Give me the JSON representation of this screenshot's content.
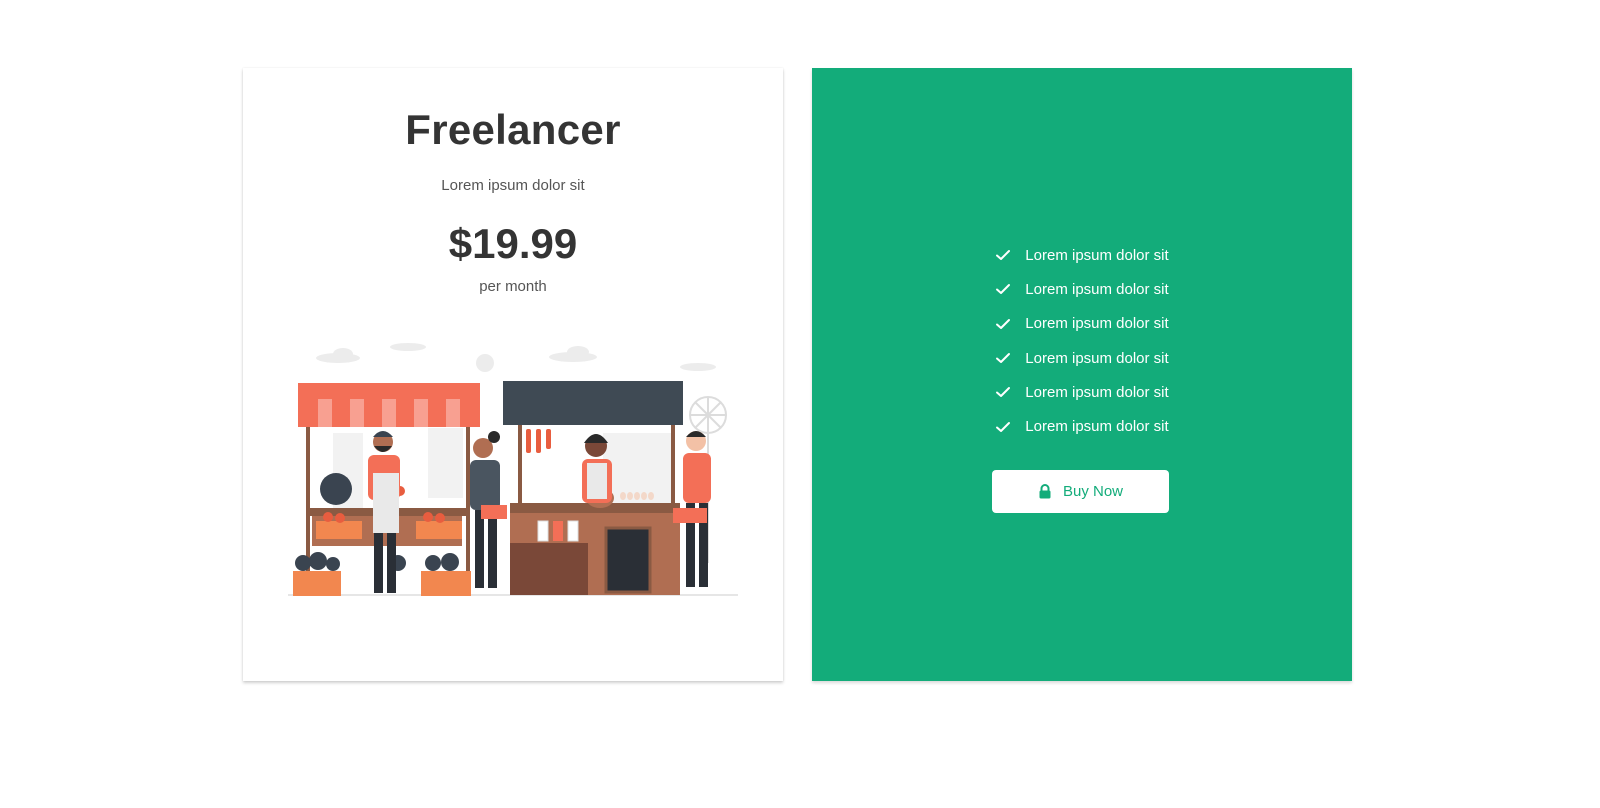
{
  "plan": {
    "title": "Freelancer",
    "subtitle": "Lorem ipsum dolor sit",
    "price": "$19.99",
    "period": "per month",
    "illustration_icon": "farmers-market-illustration"
  },
  "features": [
    {
      "label": "Lorem ipsum dolor sit",
      "icon": "check-icon"
    },
    {
      "label": "Lorem ipsum dolor sit",
      "icon": "check-icon"
    },
    {
      "label": "Lorem ipsum dolor sit",
      "icon": "check-icon"
    },
    {
      "label": "Lorem ipsum dolor sit",
      "icon": "check-icon"
    },
    {
      "label": "Lorem ipsum dolor sit",
      "icon": "check-icon"
    },
    {
      "label": "Lorem ipsum dolor sit",
      "icon": "check-icon"
    }
  ],
  "cta": {
    "label": "Buy Now",
    "icon": "lock-icon"
  },
  "colors": {
    "accent": "#13ac7a",
    "text_dark": "#343434",
    "text_muted": "#555555",
    "awning_red": "#f36f57",
    "awning_dark": "#3f4a54"
  }
}
